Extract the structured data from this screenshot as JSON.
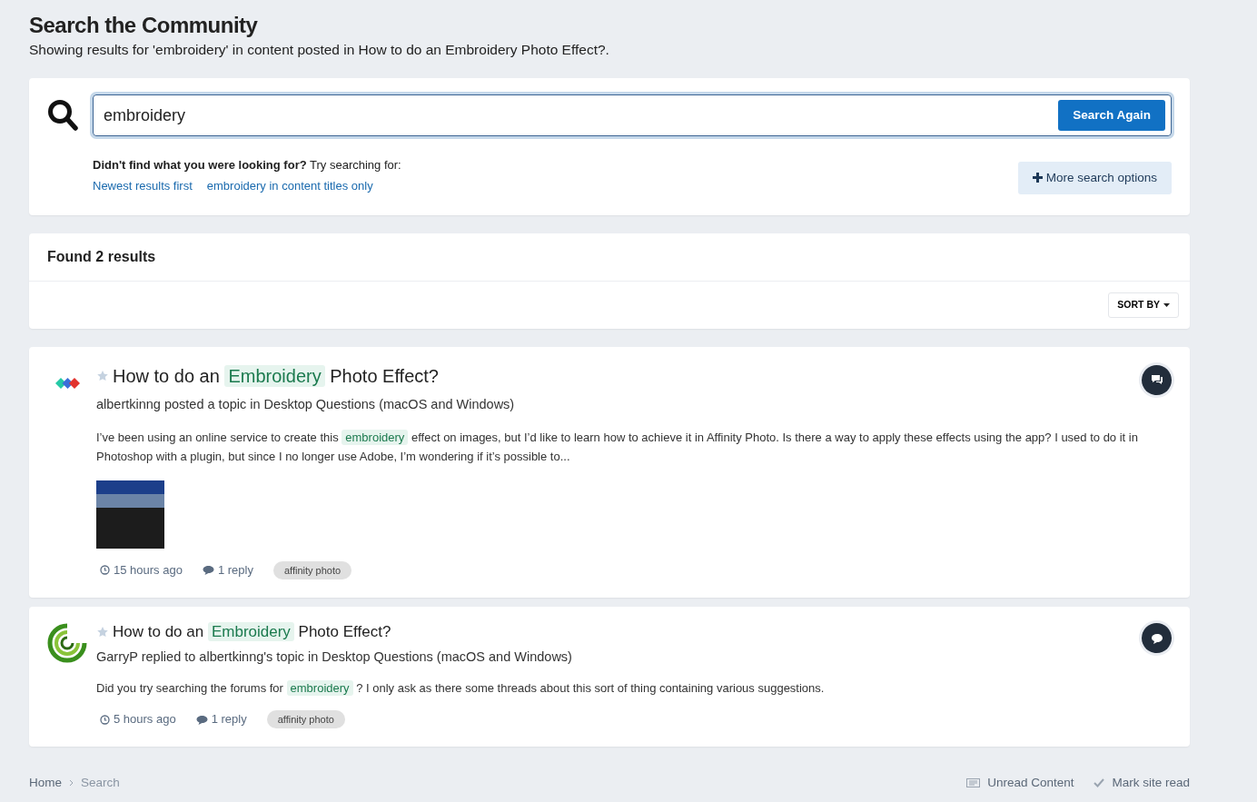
{
  "page": {
    "title": "Search the Community",
    "subtitle": "Showing results for 'embroidery' in content posted in How to do an Embroidery Photo Effect?."
  },
  "search": {
    "value": "embroidery",
    "button": "Search Again",
    "hint_bold": "Didn't find what you were looking for?",
    "hint": "Try searching for:",
    "suggestions": [
      "Newest results first",
      "embroidery in content titles only"
    ],
    "more_button": "More search options"
  },
  "results_header": {
    "title": "Found 2 results",
    "sort_button": "SORT BY"
  },
  "results": [
    {
      "title": [
        {
          "text": "How to do an",
          "highlight": false
        },
        {
          "text": "Embroidery",
          "highlight": true
        },
        {
          "text": "Photo Effect?",
          "highlight": false
        }
      ],
      "byline": "albertkinng posted a topic in Desktop Questions (macOS and Windows)",
      "snippet": [
        {
          "text": "I’ve been using an online service to create this",
          "highlight": false
        },
        {
          "text": "embroidery",
          "highlight": true
        },
        {
          "text": "effect on images, but I’d like to learn how to achieve it in Affinity Photo. Is there a way to apply these effects using the app? I used to do it in Photoshop with a plugin, but since I no longer use Adobe, I’m wondering if it’s possible to...",
          "highlight": false
        }
      ],
      "thumbnail": true,
      "time": "15 hours ago",
      "replies": "1 reply",
      "tag": "affinity photo"
    },
    {
      "title": [
        {
          "text": "How to do an",
          "highlight": false
        },
        {
          "text": "Embroidery",
          "highlight": true
        },
        {
          "text": "Photo Effect?",
          "highlight": false
        }
      ],
      "byline": "GarryP replied to albertkinng's topic in Desktop Questions (macOS and Windows)",
      "snippet": [
        {
          "text": "Did you try searching the forums for",
          "highlight": false
        },
        {
          "text": "embroidery",
          "highlight": true
        },
        {
          "text": "? I only ask as there some threads about this sort of thing containing various suggestions.",
          "highlight": false
        }
      ],
      "thumbnail": false,
      "time": "5 hours ago",
      "replies": "1 reply",
      "tag": "affinity photo"
    }
  ],
  "breadcrumb": [
    "Home",
    "Search"
  ],
  "footer_links": [
    {
      "label": "Unread Content"
    },
    {
      "label": "Mark site read"
    }
  ]
}
